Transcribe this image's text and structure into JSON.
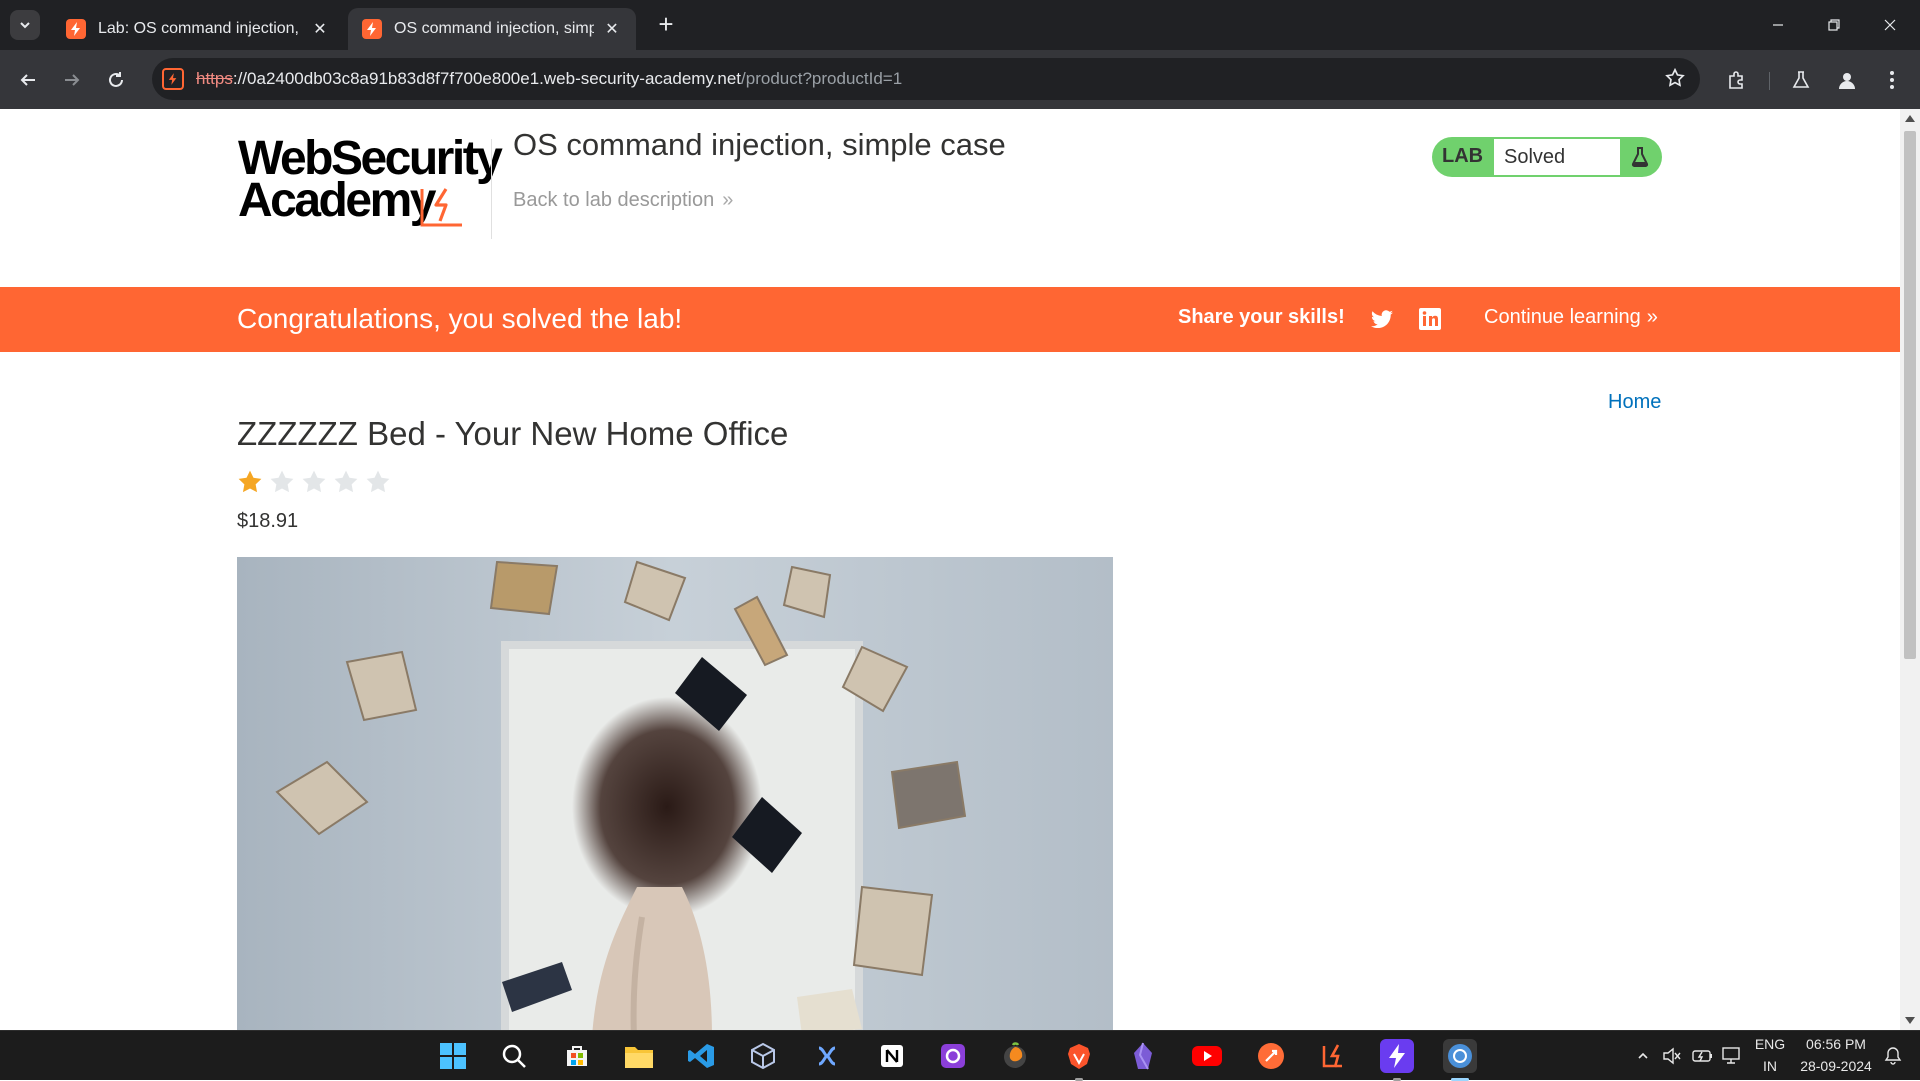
{
  "browser": {
    "tabs": [
      {
        "title": "Lab: OS command injection, simple case",
        "active": false
      },
      {
        "title": "OS command injection, simple case",
        "active": true
      }
    ],
    "url_scheme": "https",
    "url_host": "://0a2400db03c8a91b83d8f7f700e800e1.web-security-academy.net",
    "url_path": "/product?productId=1"
  },
  "header": {
    "logo_line1": "WebSecurity",
    "logo_line2": "Academy",
    "lab_title": "OS command injection, simple case",
    "back_link": "Back to lab description",
    "back_chevron": "»",
    "lab_label": "LAB",
    "lab_status": "Solved",
    "accent_color": "#ff6633",
    "solved_color": "#70d16d"
  },
  "banner": {
    "message": "Congratulations, you solved the lab!",
    "share": "Share your skills!",
    "continue": "Continue learning",
    "continue_chevron": "»",
    "icons": [
      "twitter-icon",
      "linkedin-icon"
    ]
  },
  "product": {
    "home_link": "Home",
    "title": "ZZZZZZ Bed - Your New Home Office",
    "rating": 1,
    "rating_max": 5,
    "price": "$18.91"
  },
  "taskbar": {
    "lang_top": "ENG",
    "lang_bottom": "IN",
    "time": "06:56 PM",
    "date": "28-09-2024"
  }
}
